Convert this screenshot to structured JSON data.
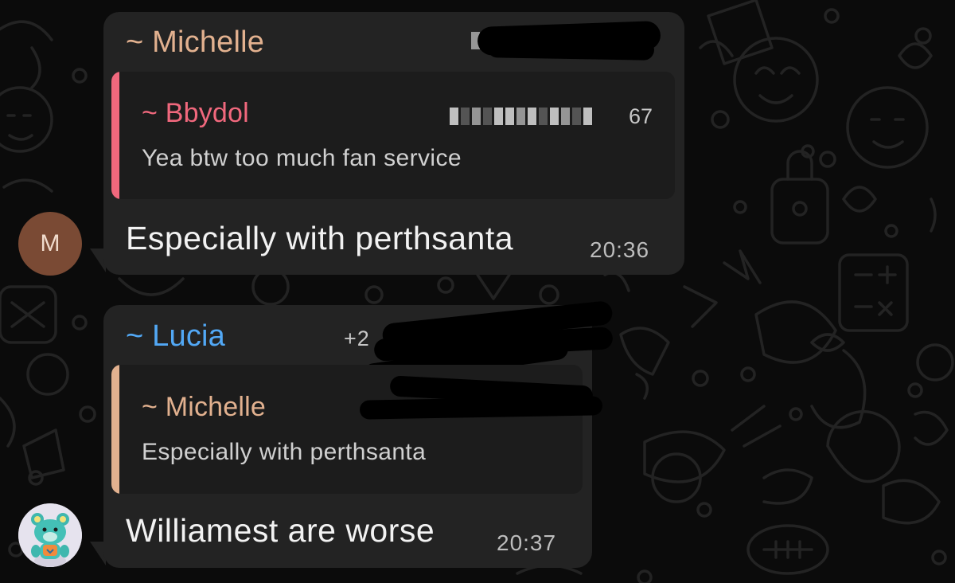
{
  "messages": [
    {
      "sender": "~ Michelle",
      "sender_color": "#e2b18f",
      "avatar_letter": "M",
      "avatar_color": "#7a4a34",
      "quote": {
        "sender": "~ Bbydol",
        "sender_color": "#f0687d",
        "phone_visible": "67",
        "text": "Yea btw too much fan service"
      },
      "text": "Especially with perthsanta",
      "time": "20:36"
    },
    {
      "sender": "~ Lucia",
      "sender_color": "#52a8f5",
      "phone_visible": "+2",
      "avatar_icon": "teal-bear-sticker-icon",
      "quote": {
        "sender": "~ Michelle",
        "sender_color": "#e2b18f",
        "text": "Especially with perthsanta"
      },
      "text": "Williamest are worse",
      "time": "20:37"
    }
  ],
  "theme": {
    "background": "#0b0b0b",
    "bubble": "#232323",
    "quote_box": "#1c1c1c"
  }
}
